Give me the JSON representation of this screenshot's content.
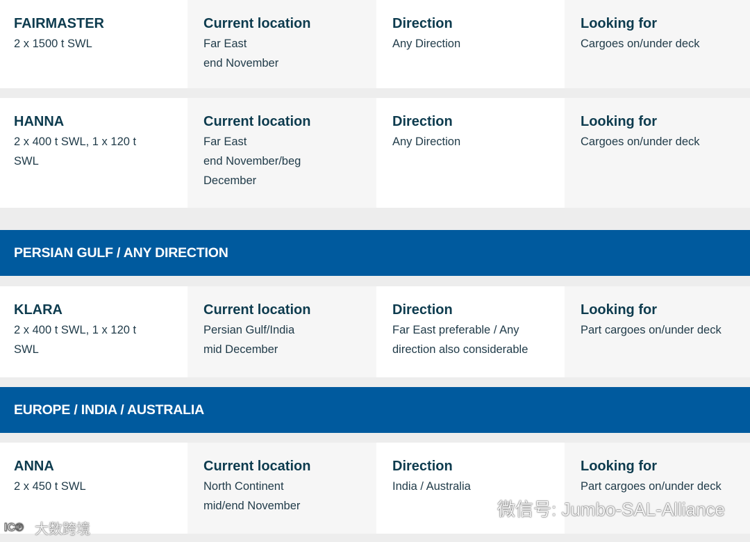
{
  "rows": [
    {
      "name": "FAIRMASTER",
      "capacity": "2 x 1500 t SWL",
      "location_title": "Current location",
      "location_lines": [
        "Far East",
        "end November"
      ],
      "direction_title": "Direction",
      "direction_lines": [
        "Any Direction"
      ],
      "looking_title": "Looking for",
      "looking_lines": [
        "Cargoes on/under deck"
      ]
    },
    {
      "name": "HANNA",
      "capacity": "2 x 400 t SWL, 1 x 120 t SWL",
      "location_title": "Current location",
      "location_lines": [
        "Far East",
        "end November/beg December"
      ],
      "direction_title": "Direction",
      "direction_lines": [
        "Any Direction"
      ],
      "looking_title": "Looking for",
      "looking_lines": [
        "Cargoes on/under deck"
      ]
    },
    {
      "name": "KLARA",
      "capacity": "2 x 400 t SWL, 1 x 120 t SWL",
      "location_title": "Current location",
      "location_lines": [
        "Persian Gulf/India",
        "mid December"
      ],
      "direction_title": "Direction",
      "direction_lines": [
        "Far East preferable / Any direction also considerable"
      ],
      "looking_title": "Looking for",
      "looking_lines": [
        "Part cargoes on/under deck"
      ]
    },
    {
      "name": "ANNA",
      "capacity": "2 x 450 t SWL",
      "location_title": "Current location",
      "location_lines": [
        "North Continent",
        "mid/end November"
      ],
      "direction_title": "Direction",
      "direction_lines": [
        "India / Australia"
      ],
      "looking_title": "Looking for",
      "looking_lines": [
        "Part cargoes on/under deck"
      ]
    }
  ],
  "sections": [
    {
      "label": "PERSIAN GULF / ANY DIRECTION"
    },
    {
      "label": "EUROPE / INDIA / AUSTRALIA"
    }
  ],
  "watermarks": {
    "left_text": "大数跨境",
    "right_text": "微信号: Jumbo-SAL-Alliance"
  },
  "colors": {
    "section_bg": "#005a9e",
    "title_text": "#0d3b4e",
    "cell_alt_bg": "#f6f6f6",
    "page_bg": "#ededed"
  }
}
